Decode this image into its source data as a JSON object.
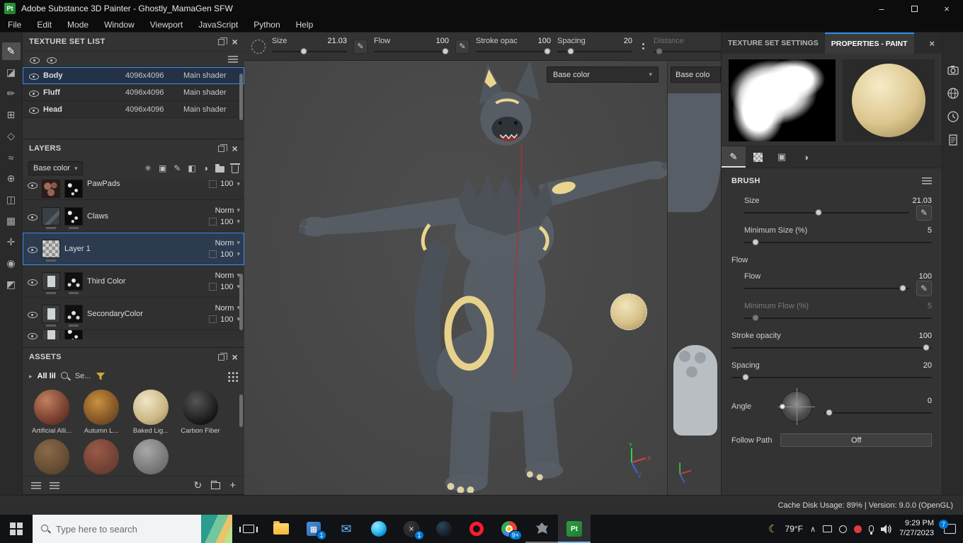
{
  "titlebar": {
    "app_badge": "Pt",
    "title": "Adobe Substance 3D Painter - Ghostly_MamaGen SFW",
    "minimize": "–",
    "close": "×"
  },
  "menubar": {
    "items": [
      "File",
      "Edit",
      "Mode",
      "Window",
      "Viewport",
      "JavaScript",
      "Python",
      "Help"
    ]
  },
  "brush_toolbar": {
    "size": {
      "label": "Size",
      "value": "21.03"
    },
    "flow": {
      "label": "Flow",
      "value": "100"
    },
    "stroke": {
      "label": "Stroke opac",
      "value": "100"
    },
    "spacing": {
      "label": "Spacing",
      "value": "20"
    },
    "distance": {
      "label": "Distance"
    }
  },
  "texture_set_list": {
    "title": "TEXTURE SET LIST",
    "rows": [
      {
        "name": "Body",
        "resolution": "4096x4096",
        "shader": "Main shader"
      },
      {
        "name": "Fluff",
        "resolution": "4096x4096",
        "shader": "Main shader"
      },
      {
        "name": "Head",
        "resolution": "4096x4096",
        "shader": "Main shader"
      }
    ]
  },
  "layers_panel": {
    "title": "LAYERS",
    "channel_selector": "Base color",
    "rows": [
      {
        "name": "PawPads",
        "opacity": "100"
      },
      {
        "name": "Claws",
        "blend": "Norm",
        "opacity": "100"
      },
      {
        "name": "Layer 1",
        "blend": "Norm",
        "opacity": "100"
      },
      {
        "name": "Third Color",
        "blend": "Norm",
        "opacity": "100"
      },
      {
        "name": "SecondaryColor",
        "blend": "Norm",
        "opacity": "100"
      }
    ]
  },
  "assets_panel": {
    "title": "ASSETS",
    "filter_label": "All lil",
    "search_text": "Se...",
    "items": [
      {
        "label": "Artificial Alli..."
      },
      {
        "label": "Autumn L..."
      },
      {
        "label": "Baked Lig..."
      },
      {
        "label": "Carbon Fiber"
      }
    ]
  },
  "viewport": {
    "channel_dropdown": "Base color",
    "channel_dropdown_2": "Base colo",
    "axis": {
      "x": "X",
      "y": "Y",
      "z": "Z"
    }
  },
  "right_panel": {
    "tabs": [
      {
        "label": "TEXTURE SET SETTINGS"
      },
      {
        "label": "PROPERTIES - PAINT"
      }
    ],
    "brush_section": {
      "title": "BRUSH",
      "size_label": "Size",
      "size_value": "21.03",
      "min_size_label": "Minimum Size (%)",
      "min_size_value": "5",
      "flow_group_label": "Flow",
      "flow_label": "Flow",
      "flow_value": "100",
      "min_flow_label": "Minimum Flow (%)",
      "min_flow_value": "5",
      "stroke_opacity_label": "Stroke opacity",
      "stroke_opacity_value": "100",
      "spacing_label": "Spacing",
      "spacing_value": "20",
      "angle_label": "Angle",
      "angle_value": "0",
      "follow_path_label": "Follow Path",
      "follow_path_value": "Off"
    },
    "status_text": "Cache Disk Usage:  89% | Version: 9.0.0 (OpenGL)"
  },
  "taskbar": {
    "search_placeholder": "Type here to search",
    "painter_badge": "Pt",
    "badges": {
      "app1": "1",
      "xbox": "1",
      "browser": "9+",
      "notifications": "7"
    },
    "tray": {
      "temperature": "79°F",
      "time": "9:29 PM",
      "date": "7/27/2023"
    }
  }
}
